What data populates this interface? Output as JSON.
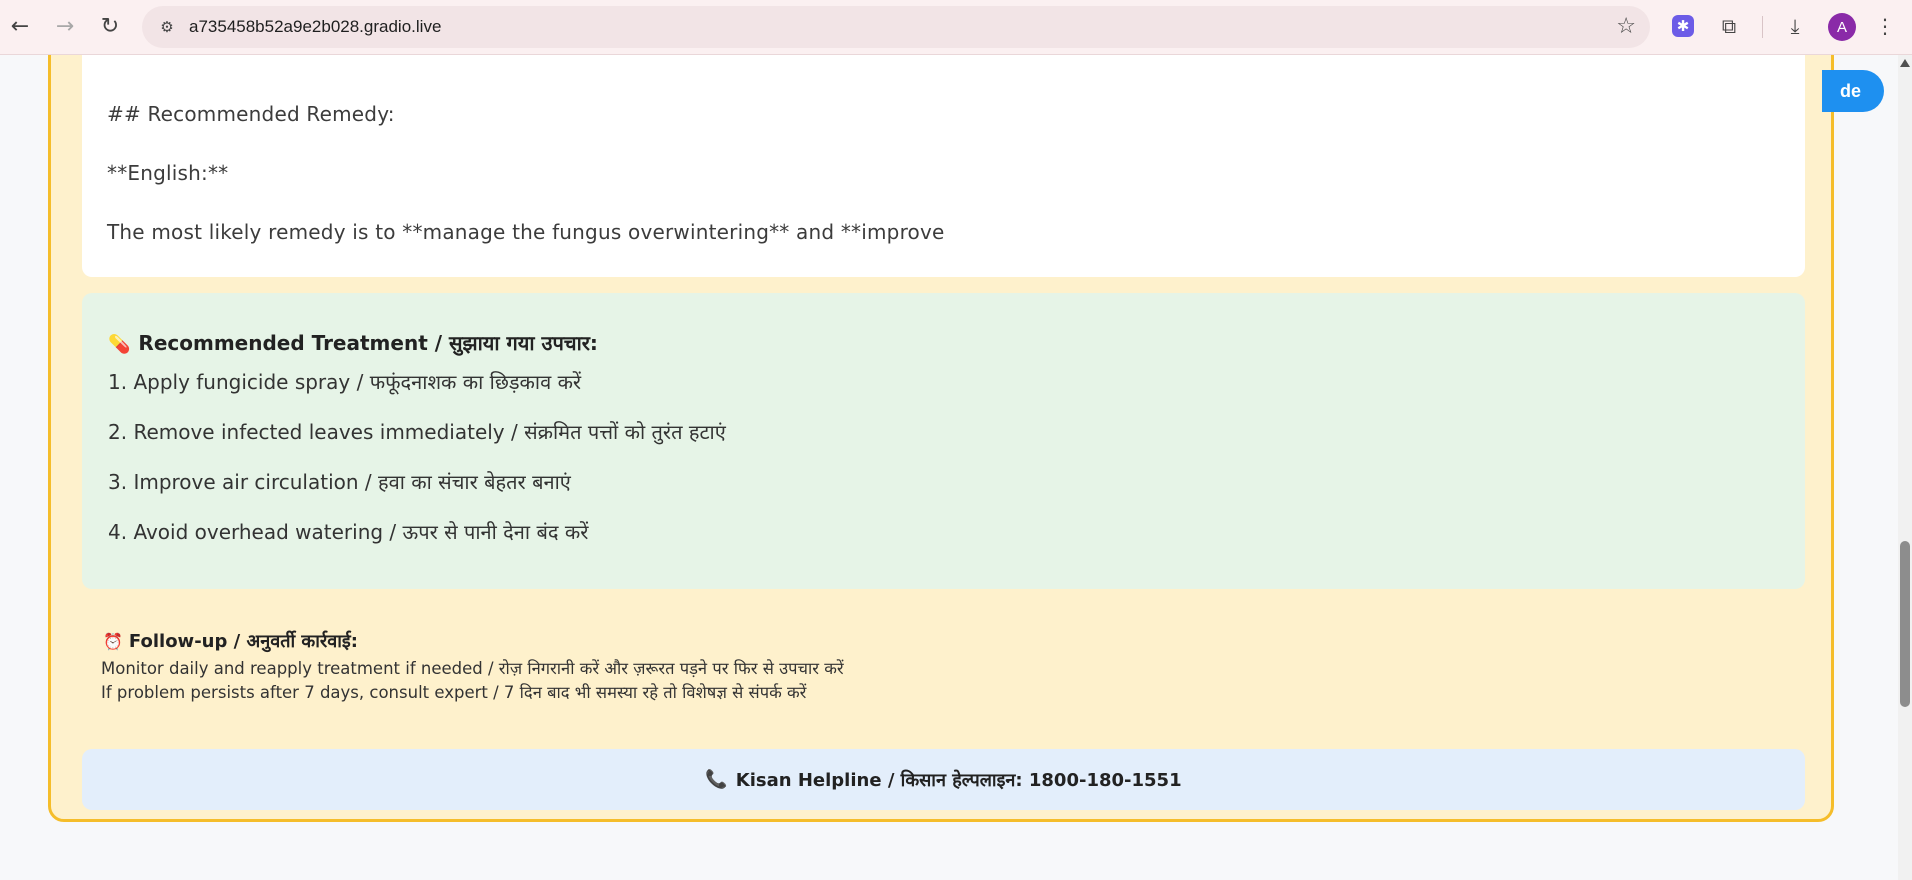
{
  "browser": {
    "url": "a735458b52a9e2b028.gradio.live",
    "avatar_letter": "A"
  },
  "page": {
    "floating_button_label": "de",
    "remedy": {
      "heading": "## Recommended Remedy:",
      "english_label": "**English:**",
      "text": "The most likely remedy is to **manage the fungus overwintering** and **improve"
    },
    "treatment": {
      "title": "Recommended Treatment / सुझाया गया उपचार:",
      "items": [
        "1. Apply fungicide spray / फफूंदनाशक का छिड़काव करें",
        "2. Remove infected leaves immediately / संक्रमित पत्तों को तुरंत हटाएं",
        "3. Improve air circulation / हवा का संचार बेहतर बनाएं",
        "4. Avoid overhead watering / ऊपर से पानी देना बंद करें"
      ]
    },
    "followup": {
      "title": "Follow-up / अनुवर्ती कार्रवाई:",
      "lines": [
        "Monitor daily and reapply treatment if needed / रोज़ निगरानी करें और ज़रूरत पड़ने पर फिर से उपचार करें",
        "If problem persists after 7 days, consult expert / 7 दिन बाद भी समस्या रहे तो विशेषज्ञ से संपर्क करें"
      ]
    },
    "helpline": {
      "text": "Kisan Helpline / किसान हेल्पलाइन: 1800-180-1551"
    }
  },
  "colors": {
    "outer_card_bg": "#fef1cc",
    "outer_card_border": "#f5bd2a",
    "treatment_bg": "#e6f4e7",
    "helpline_bg": "#e3eefb",
    "accent_button": "#1e90f0"
  }
}
